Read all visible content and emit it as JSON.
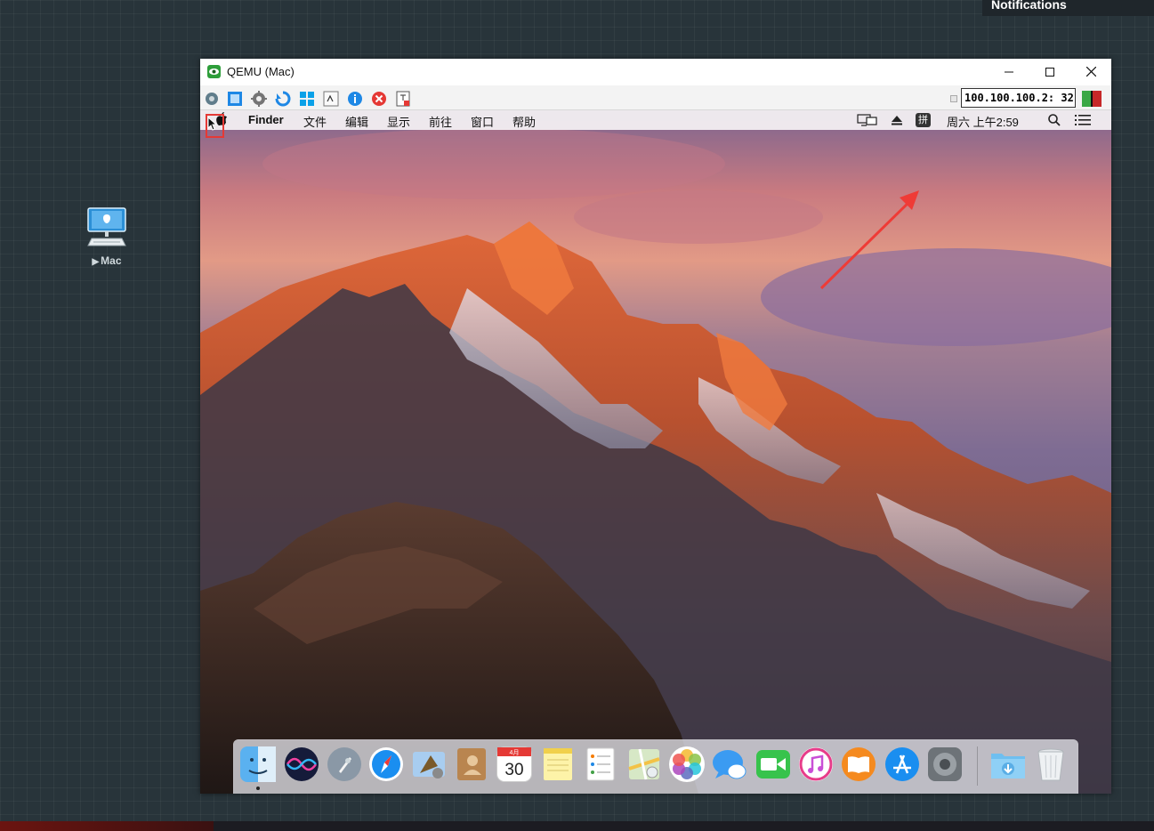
{
  "notifications": {
    "label": "Notifications"
  },
  "desktop": {
    "node": {
      "label": "Mac",
      "icon": "apple-computer-icon"
    }
  },
  "window": {
    "title": "QEMU (Mac)",
    "icon": "qemu-eye-icon",
    "controls": {
      "minimize": "—",
      "maximize": "☐",
      "close": "✕"
    },
    "toolbar": {
      "buttons": [
        {
          "name": "screenshot-button",
          "icon": "camera-icon"
        },
        {
          "name": "fullscreen-button",
          "icon": "fullscreen-icon"
        },
        {
          "name": "settings-button",
          "icon": "gear-icon"
        },
        {
          "name": "refresh-button",
          "icon": "refresh-icon"
        },
        {
          "name": "windows-button",
          "icon": "windows-logo-icon"
        },
        {
          "name": "terminal-button",
          "icon": "terminal-icon"
        },
        {
          "name": "info-button",
          "icon": "info-icon"
        },
        {
          "name": "stop-button",
          "icon": "stop-icon"
        },
        {
          "name": "disconnect-button",
          "icon": "disconnect-icon"
        }
      ],
      "address": "100.100.100.2: 32",
      "status_colors": [
        "#3aa845",
        "#c62828"
      ]
    }
  },
  "mac": {
    "menubar": {
      "app": "Finder",
      "items": [
        "文件",
        "编辑",
        "显示",
        "前往",
        "窗口",
        "帮助"
      ],
      "status": {
        "input_method": "拼",
        "clock": "周六 上午2:59"
      }
    },
    "dock": [
      {
        "name": "finder",
        "icon": "finder-icon"
      },
      {
        "name": "siri",
        "icon": "siri-icon"
      },
      {
        "name": "launchpad",
        "icon": "launchpad-icon"
      },
      {
        "name": "safari",
        "icon": "safari-icon"
      },
      {
        "name": "mail",
        "icon": "mail-icon"
      },
      {
        "name": "contacts",
        "icon": "contacts-icon"
      },
      {
        "name": "calendar",
        "icon": "calendar-icon",
        "month": "4月",
        "day": "30"
      },
      {
        "name": "notes",
        "icon": "notes-icon"
      },
      {
        "name": "reminders",
        "icon": "reminders-icon"
      },
      {
        "name": "maps",
        "icon": "maps-icon"
      },
      {
        "name": "photos",
        "icon": "photos-icon"
      },
      {
        "name": "messages",
        "icon": "messages-icon"
      },
      {
        "name": "facetime",
        "icon": "facetime-icon"
      },
      {
        "name": "itunes",
        "icon": "itunes-icon"
      },
      {
        "name": "ibooks",
        "icon": "ibooks-icon"
      },
      {
        "name": "app-store",
        "icon": "app-store-icon"
      },
      {
        "name": "system-preferences",
        "icon": "system-preferences-icon"
      },
      {
        "name": "downloads",
        "icon": "downloads-folder-icon"
      },
      {
        "name": "trash",
        "icon": "trash-icon"
      }
    ]
  }
}
